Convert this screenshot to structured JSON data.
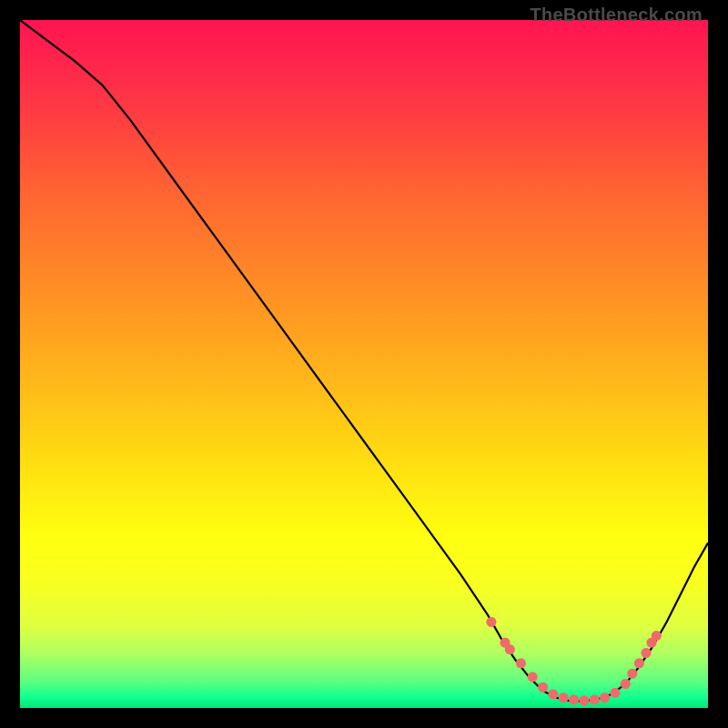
{
  "watermark": "TheBottleneck.com",
  "chart_data": {
    "type": "line",
    "title": "",
    "xlabel": "",
    "ylabel": "",
    "xlim": [
      0,
      100
    ],
    "ylim": [
      0,
      100
    ],
    "series": [
      {
        "name": "curve",
        "x": [
          0,
          4,
          8,
          12,
          16,
          20,
          24,
          28,
          32,
          36,
          40,
          44,
          48,
          52,
          56,
          60,
          64,
          68,
          70,
          72,
          74,
          76,
          78,
          80,
          82,
          84,
          86,
          88,
          90,
          92,
          94,
          96,
          98,
          100
        ],
        "y": [
          100,
          97,
          94,
          90.5,
          85.5,
          80,
          74.5,
          69,
          63.5,
          58,
          52.5,
          47,
          41.5,
          36,
          30.5,
          25,
          19.5,
          13.5,
          10,
          7,
          4.5,
          2.5,
          1.5,
          1,
          1,
          1.3,
          2,
          3.5,
          6,
          9,
          12.5,
          16.5,
          20.5,
          24
        ]
      }
    ],
    "markers": {
      "name": "highlight-dots",
      "x": [
        68.5,
        70.5,
        71.2,
        72.8,
        74.5,
        76,
        77.5,
        79,
        80.5,
        82,
        83.5,
        85,
        86.5,
        88,
        89,
        90,
        91,
        91.8,
        92.5
      ],
      "y": [
        12.5,
        9.5,
        8.5,
        6.5,
        4.5,
        3,
        2,
        1.5,
        1.2,
        1.1,
        1.2,
        1.5,
        2.2,
        3.5,
        5,
        6.5,
        8,
        9.5,
        10.5
      ]
    },
    "gradient_stops": [
      {
        "pos": 0,
        "color": "#ff1450"
      },
      {
        "pos": 50,
        "color": "#ffc018"
      },
      {
        "pos": 80,
        "color": "#ffff10"
      },
      {
        "pos": 100,
        "color": "#00e878"
      }
    ]
  }
}
